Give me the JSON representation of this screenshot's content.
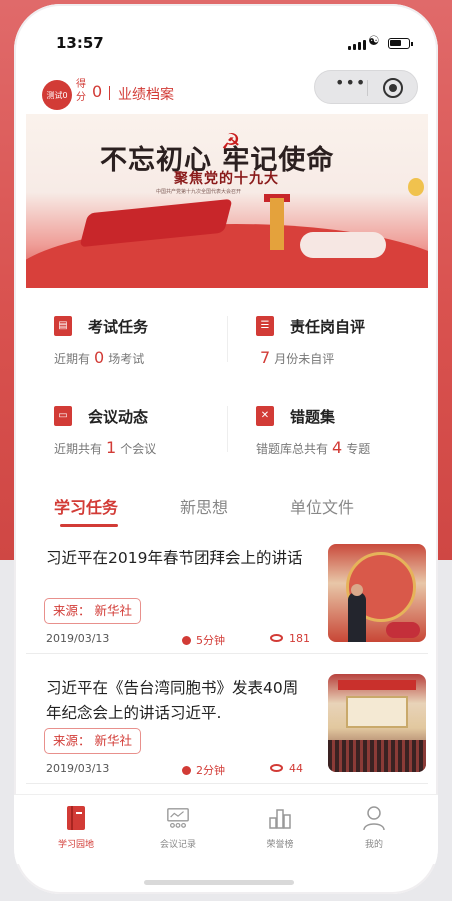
{
  "status_bar": {
    "time": "13:57"
  },
  "nav": {
    "avatar_text": "测试0",
    "score_label": "得分",
    "score_value": "0",
    "separator": "|",
    "link": "业绩档案"
  },
  "banner": {
    "title": "不忘初心 牢记使命",
    "subtitle": "聚焦党的十九大",
    "small_text": "中国共产党第十九次全国代表大会召开"
  },
  "cards": [
    {
      "title": "考试任务",
      "prefix": "近期有",
      "value": "0",
      "suffix": "场考试",
      "icon": "exam-icon"
    },
    {
      "title": "责任岗自评",
      "prefix": "",
      "value": "7",
      "suffix": "月份未自评",
      "icon": "self-review-icon"
    },
    {
      "title": "会议动态",
      "prefix": "近期共有",
      "value": "1",
      "suffix": "个会议",
      "icon": "meeting-icon"
    },
    {
      "title": "错题集",
      "prefix": "错题库总共有",
      "value": "4",
      "suffix": "专题",
      "icon": "wrong-questions-icon"
    }
  ],
  "tabs": [
    "学习任务",
    "新思想",
    "单位文件"
  ],
  "articles": [
    {
      "title": "习近平在2019年春节团拜会上的讲话",
      "source": "来源： 新华社",
      "date": "2019/03/13",
      "duration": "5分钟",
      "views": "181"
    },
    {
      "title": "习近平在《告台湾同胞书》发表40周年纪念会上的讲话习近平.",
      "source": "来源： 新华社",
      "date": "2019/03/13",
      "duration": "2分钟",
      "views": "44"
    }
  ],
  "tabbar": [
    {
      "label": "学习园地",
      "active": true
    },
    {
      "label": "会议记录",
      "active": false
    },
    {
      "label": "荣誉榜",
      "active": false
    },
    {
      "label": "我的",
      "active": false
    }
  ],
  "colors": {
    "accent": "#d23b36",
    "background_top": "#d9524f"
  }
}
